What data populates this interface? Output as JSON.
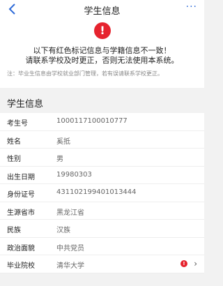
{
  "nav": {
    "title": "学生信息",
    "back_icon": "chevron-left-icon",
    "more_icon": "more-dots-icon",
    "more_glyph": "···",
    "accent": "#2f6bd8"
  },
  "alert": {
    "icon": "exclamation-icon",
    "icon_glyph": "!",
    "icon_color": "#e6232e",
    "message": "以下有红色标记信息与学籍信息不一致！\n请联系学校及时更正，否则无法使用本系统。",
    "note": "注：毕业生信息由学校就业部门管理，若有误请联系学校更正。"
  },
  "section": {
    "title": "学生信息"
  },
  "rows": [
    {
      "label": "考生号",
      "value": "1000117100010777"
    },
    {
      "label": "姓名",
      "value": "奚抵"
    },
    {
      "label": "性别",
      "value": "男"
    },
    {
      "label": "出生日期",
      "value": "19980303"
    },
    {
      "label": "身份证号",
      "value": "431102199401013444"
    },
    {
      "label": "生源省市",
      "value": "黑龙江省"
    },
    {
      "label": "民族",
      "value": "汉族"
    },
    {
      "label": "政治面貌",
      "value": "中共党员"
    },
    {
      "label": "毕业院校",
      "value": "清华大学",
      "warn": "!",
      "chevron": "›"
    }
  ]
}
